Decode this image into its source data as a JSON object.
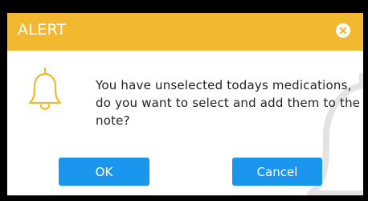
{
  "dialog": {
    "title": "ALERT",
    "close_icon": "close-circle-icon",
    "bell_icon": "bell-icon",
    "message": "You have unselected todays medications, do you want to select and add them to the note?",
    "ok_label": "OK",
    "cancel_label": "Cancel"
  },
  "colors": {
    "header": "#f2b82f",
    "button": "#1a96ef",
    "bell": "#f2b82f",
    "background": "#000000"
  }
}
